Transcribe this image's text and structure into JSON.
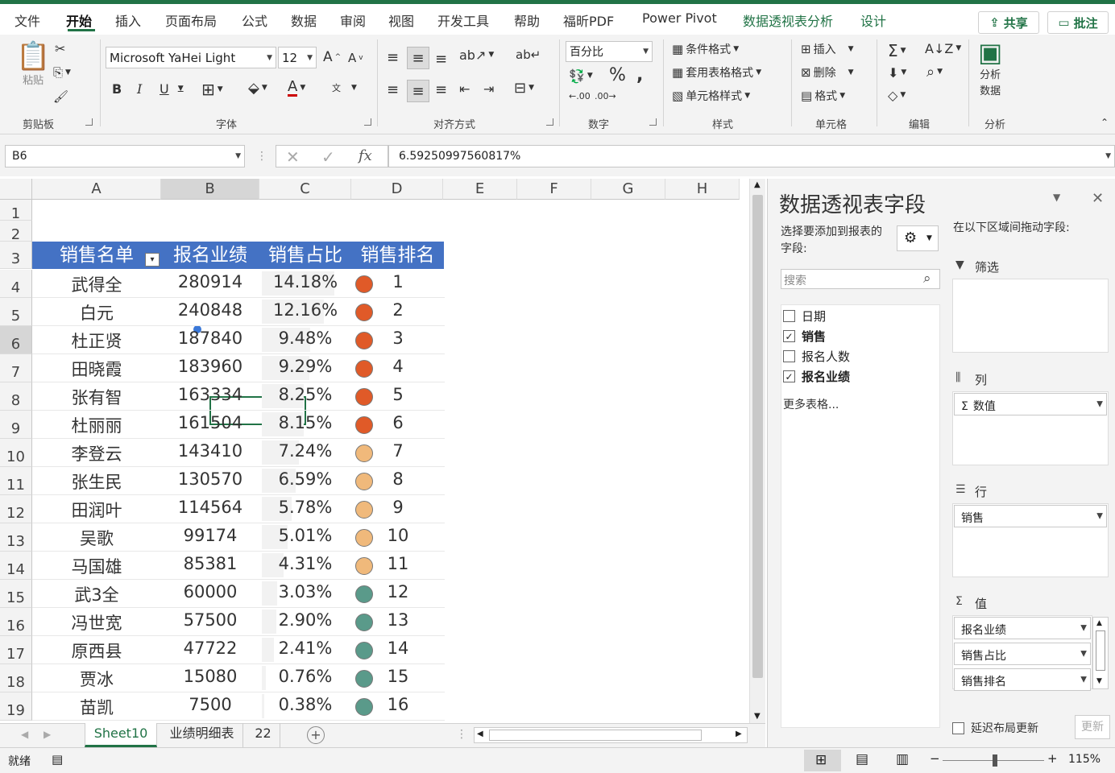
{
  "ribbon_tabs": [
    "文件",
    "开始",
    "插入",
    "页面布局",
    "公式",
    "数据",
    "审阅",
    "视图",
    "开发工具",
    "帮助",
    "福昕PDF",
    "Power Pivot",
    "数据透视表分析",
    "设计"
  ],
  "share_label": "共享",
  "comment_label": "批注",
  "clipboard": {
    "paste": "粘贴",
    "group": "剪贴板"
  },
  "font": {
    "name": "Microsoft YaHei Light",
    "size": "12",
    "group": "字体"
  },
  "align": {
    "group": "对齐方式"
  },
  "number": {
    "format": "百分比",
    "group": "数字"
  },
  "styles": {
    "cond": "条件格式",
    "table": "套用表格格式",
    "cell": "单元格样式",
    "group": "样式"
  },
  "cells": {
    "insert": "插入",
    "delete": "删除",
    "format": "格式",
    "group": "单元格"
  },
  "edit": {
    "group": "编辑"
  },
  "analysis": {
    "btn": "分析\n数据",
    "line1": "分析",
    "line2": "数据",
    "group": "分析"
  },
  "formula_bar": {
    "name_box": "B6",
    "formula": "6.59250997560817%"
  },
  "columns": [
    "A",
    "B",
    "C",
    "D",
    "E",
    "F",
    "G",
    "H"
  ],
  "rows": [
    "1",
    "2",
    "3",
    "4",
    "5",
    "6",
    "7",
    "8",
    "9",
    "10",
    "11",
    "12",
    "13",
    "14",
    "15",
    "16",
    "17",
    "18",
    "19"
  ],
  "table": {
    "headers": [
      "销售名单",
      "报名业绩",
      "销售占比",
      "销售排名"
    ],
    "data": [
      {
        "name": "武得全",
        "value": "280914",
        "pct": "14.18%",
        "rank": "1",
        "level": "high"
      },
      {
        "name": "白元",
        "value": "240848",
        "pct": "12.16%",
        "rank": "2",
        "level": "high"
      },
      {
        "name": "杜正贤",
        "value": "187840",
        "pct": "9.48%",
        "rank": "3",
        "level": "high"
      },
      {
        "name": "田晓霞",
        "value": "183960",
        "pct": "9.29%",
        "rank": "4",
        "level": "high"
      },
      {
        "name": "张有智",
        "value": "163334",
        "pct": "8.25%",
        "rank": "5",
        "level": "high"
      },
      {
        "name": "杜丽丽",
        "value": "161504",
        "pct": "8.15%",
        "rank": "6",
        "level": "high"
      },
      {
        "name": "李登云",
        "value": "143410",
        "pct": "7.24%",
        "rank": "7",
        "level": "mid"
      },
      {
        "name": "张生民",
        "value": "130570",
        "pct": "6.59%",
        "rank": "8",
        "level": "mid"
      },
      {
        "name": "田润叶",
        "value": "114564",
        "pct": "5.78%",
        "rank": "9",
        "level": "mid"
      },
      {
        "name": "吴歌",
        "value": "99174",
        "pct": "5.01%",
        "rank": "10",
        "level": "mid"
      },
      {
        "name": "马国雄",
        "value": "85381",
        "pct": "4.31%",
        "rank": "11",
        "level": "mid"
      },
      {
        "name": "武3全",
        "value": "60000",
        "pct": "3.03%",
        "rank": "12",
        "level": "low"
      },
      {
        "name": "冯世宽",
        "value": "57500",
        "pct": "2.90%",
        "rank": "13",
        "level": "low"
      },
      {
        "name": "原西县",
        "value": "47722",
        "pct": "2.41%",
        "rank": "14",
        "level": "low"
      },
      {
        "name": "贾冰",
        "value": "15080",
        "pct": "0.76%",
        "rank": "15",
        "level": "low"
      },
      {
        "name": "苗凯",
        "value": "7500",
        "pct": "0.38%",
        "rank": "16",
        "level": "low"
      }
    ]
  },
  "dot_colors": {
    "high": "#e05a28",
    "mid": "#f0b97b",
    "low": "#5a9a8a"
  },
  "sheet_tabs": [
    "Sheet10",
    "业绩明细表",
    "22"
  ],
  "status": {
    "ready": "就绪",
    "zoom": "115%"
  },
  "pivot_pane": {
    "title": "数据透视表字段",
    "choose_label": "选择要添加到报表的字段:",
    "drag_label": "在以下区域间拖动字段:",
    "search_placeholder": "搜索",
    "fields": [
      {
        "label": "日期",
        "checked": false
      },
      {
        "label": "销售",
        "checked": true
      },
      {
        "label": "报名人数",
        "checked": false
      },
      {
        "label": "报名业绩",
        "checked": true
      }
    ],
    "more_tables": "更多表格...",
    "filter_label": "筛选",
    "columns_label": "列",
    "rows_label": "行",
    "values_label": "值",
    "columns_item": "数值",
    "rows_item": "销售",
    "values_items": [
      "报名业绩",
      "销售占比",
      "销售排名"
    ],
    "defer_label": "延迟布局更新",
    "update_label": "更新"
  }
}
